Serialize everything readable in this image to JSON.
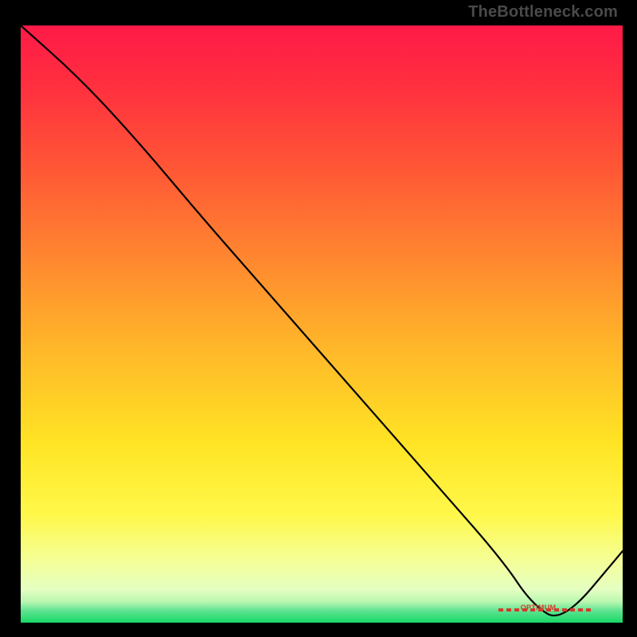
{
  "credit": "TheBottleneck.com",
  "marker_label": "OPTIMUM",
  "colors": {
    "curve": "#000000",
    "marker": "#d43b2d",
    "credit": "#4a4a4a"
  },
  "chart_data": {
    "type": "line",
    "title": "",
    "xlabel": "",
    "ylabel": "",
    "xlim": [
      0,
      100
    ],
    "ylim": [
      0,
      100
    ],
    "gradient_stops": [
      {
        "offset": 0.0,
        "color": "#ff1a48"
      },
      {
        "offset": 0.1,
        "color": "#ff2f3f"
      },
      {
        "offset": 0.25,
        "color": "#ff5a35"
      },
      {
        "offset": 0.4,
        "color": "#ff8a2f"
      },
      {
        "offset": 0.55,
        "color": "#ffba29"
      },
      {
        "offset": 0.7,
        "color": "#ffe424"
      },
      {
        "offset": 0.82,
        "color": "#fff84a"
      },
      {
        "offset": 0.9,
        "color": "#f4ff9b"
      },
      {
        "offset": 0.945,
        "color": "#e4ffc2"
      },
      {
        "offset": 0.965,
        "color": "#b9f7b0"
      },
      {
        "offset": 0.98,
        "color": "#5ee490"
      },
      {
        "offset": 1.0,
        "color": "#17d765"
      }
    ],
    "series": [
      {
        "name": "bottleneck-curve",
        "x": [
          0,
          10,
          20,
          30,
          40,
          50,
          60,
          70,
          80,
          85,
          90,
          100
        ],
        "y": [
          100,
          91,
          80,
          68,
          56.5,
          45,
          33.5,
          22,
          10.5,
          3,
          0,
          12
        ]
      }
    ],
    "annotations": [
      {
        "name": "optimum",
        "x": 87,
        "y": 0,
        "label": "OPTIMUM"
      }
    ]
  }
}
